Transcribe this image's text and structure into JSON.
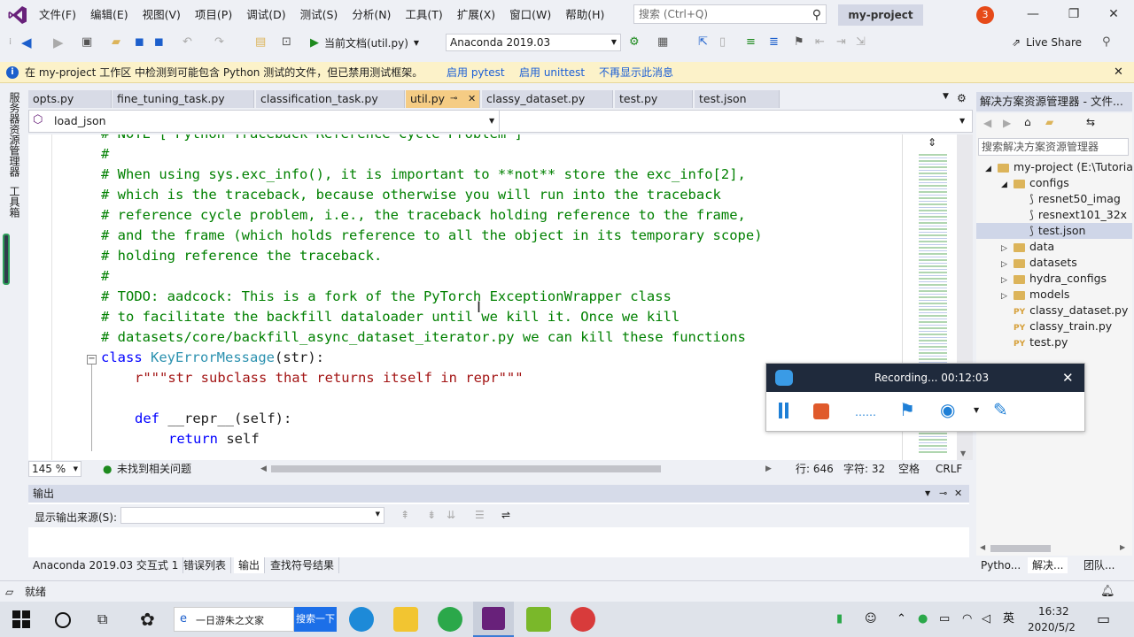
{
  "menu": [
    "文件(F)",
    "编辑(E)",
    "视图(V)",
    "项目(P)",
    "调试(D)",
    "测试(S)",
    "分析(N)",
    "工具(T)",
    "扩展(X)",
    "窗口(W)",
    "帮助(H)"
  ],
  "search": {
    "placeholder": "搜索 (Ctrl+Q)"
  },
  "project_name": "my-project",
  "notification_count": "3",
  "toolbar": {
    "run_label": "当前文档(util.py)",
    "env_label": "Anaconda 2019.03",
    "live_share": "Live Share"
  },
  "infobar": {
    "message": "在 my-project 工作区 中检测到可能包含 Python 测试的文件，但已禁用测试框架。",
    "link1": "启用 pytest",
    "link2": "启用 unittest",
    "link3": "不再显示此消息"
  },
  "left_sidebar": [
    "服务器资源管理器",
    "工具箱"
  ],
  "tabs": [
    {
      "label": "opts.py"
    },
    {
      "label": "fine_tuning_task.py"
    },
    {
      "label": "classification_task.py"
    },
    {
      "label": "util.py"
    },
    {
      "label": "classy_dataset.py"
    },
    {
      "label": "test.py"
    },
    {
      "label": "test.json"
    }
  ],
  "navbar": {
    "function": "load_json"
  },
  "code_lines": [
    {
      "type": "comment",
      "text": "# NOTE [ Python Traceback Reference Cycle Problem ]"
    },
    {
      "type": "comment",
      "text": "#"
    },
    {
      "type": "comment",
      "text": "# When using sys.exc_info(), it is important to **not** store the exc_info[2],"
    },
    {
      "type": "comment",
      "text": "# which is the traceback, because otherwise you will run into the traceback"
    },
    {
      "type": "comment",
      "text": "# reference cycle problem, i.e., the traceback holding reference to the frame,"
    },
    {
      "type": "comment",
      "text": "# and the frame (which holds reference to all the object in its temporary scope)"
    },
    {
      "type": "comment",
      "text": "# holding reference the traceback."
    },
    {
      "type": "comment",
      "text": "#"
    },
    {
      "type": "comment",
      "text": "# TODO: aadcock: This is a fork of the PyTorch ExceptionWrapper class"
    },
    {
      "type": "comment",
      "text": "# to facilitate the backfill dataloader until we kill it. Once we kill"
    },
    {
      "type": "comment",
      "text": "# datasets/core/backfill_async_dataset_iterator.py we can kill these functions"
    }
  ],
  "code_class": {
    "kw": "class",
    "name": "KeyErrorMessage",
    "args": "(str):"
  },
  "code_doc": "r\"\"\"str subclass that returns itself in repr\"\"\"",
  "code_def": {
    "kw": "def",
    "name": "__repr__",
    "args": "(self):"
  },
  "code_return": {
    "kw": "return",
    "val": "self"
  },
  "editor_status": {
    "zoom": "145 %",
    "issues": "未找到相关问题",
    "line": "行: 646",
    "col": "字符: 32",
    "space": "空格",
    "eol": "CRLF"
  },
  "output": {
    "title": "输出",
    "source_label": "显示输出来源(S):"
  },
  "bottom_tabs": [
    "Anaconda 2019.03 交互式 1",
    "错误列表",
    "输出",
    "查找符号结果"
  ],
  "solution": {
    "title": "解决方案资源管理器 - 文件...",
    "search_placeholder": "搜索解决方案资源管理器",
    "items": [
      {
        "label": "my-project (E:\\Tutoria",
        "kind": "project",
        "indent": 0,
        "expander": "◢"
      },
      {
        "label": "configs",
        "kind": "folder",
        "indent": 1,
        "expander": "◢"
      },
      {
        "label": "resnet50_imag",
        "kind": "json",
        "indent": 2,
        "expander": ""
      },
      {
        "label": "resnext101_32x",
        "kind": "json",
        "indent": 2,
        "expander": ""
      },
      {
        "label": "test.json",
        "kind": "json",
        "indent": 2,
        "expander": "",
        "selected": true
      },
      {
        "label": "data",
        "kind": "folder",
        "indent": 1,
        "expander": "▷"
      },
      {
        "label": "datasets",
        "kind": "folder",
        "indent": 1,
        "expander": "▷"
      },
      {
        "label": "hydra_configs",
        "kind": "folder",
        "indent": 1,
        "expander": "▷"
      },
      {
        "label": "models",
        "kind": "folder",
        "indent": 1,
        "expander": "▷"
      },
      {
        "label": "classy_dataset.py",
        "kind": "py",
        "indent": 1,
        "expander": ""
      },
      {
        "label": "classy_train.py",
        "kind": "py",
        "indent": 1,
        "expander": ""
      },
      {
        "label": "test.py",
        "kind": "py",
        "indent": 1,
        "expander": ""
      }
    ],
    "tabs": [
      "Pytho...",
      "解决...",
      "团队..."
    ]
  },
  "status_ready": "就绪",
  "recorder": {
    "label": "Recording... 00:12:03"
  },
  "taskbar": {
    "search_text": "一日游朱之文家",
    "search_btn": "搜索一下",
    "ime": "英",
    "time": "16:32",
    "date": "2020/5/2"
  },
  "colors": {
    "accent": "#68217a",
    "tab_active": "#f5cc84",
    "comment": "#008000",
    "keyword": "#0000ff",
    "classname": "#2b91af",
    "string": "#a31515",
    "recorder_stop": "#e05a2b",
    "recorder_blue": "#1e7fd6"
  }
}
